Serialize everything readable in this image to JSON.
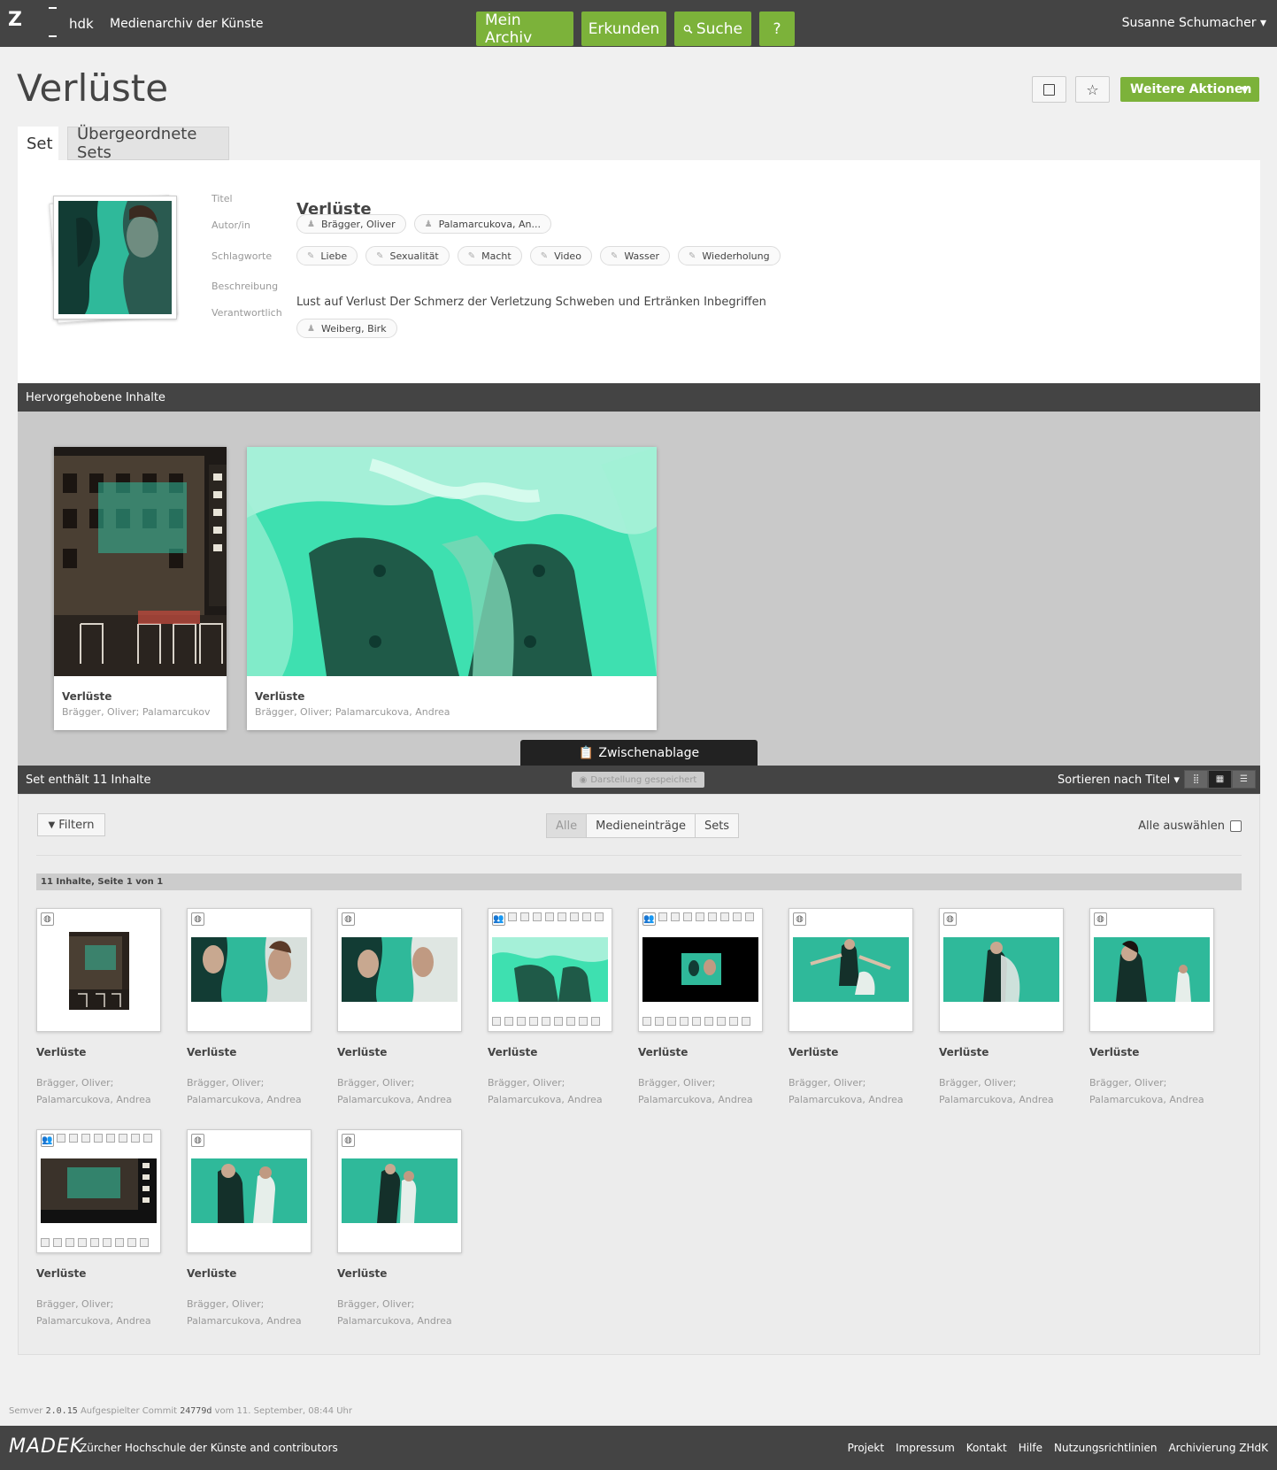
{
  "topbar": {
    "logo": "Z",
    "brand_short": "hdk",
    "brand_title": "Medienarchiv der Künste",
    "nav": [
      "Mein Archiv",
      "Erkunden",
      "Suche",
      "?"
    ],
    "user": "Susanne Schumacher ▾"
  },
  "page": {
    "title": "Verlüste",
    "more_actions": "Weitere Aktionen",
    "tabs": [
      "Set",
      "Übergeordnete Sets"
    ]
  },
  "meta": {
    "labels": [
      "Titel",
      "Autor/in",
      "Schlagworte",
      "Beschreibung",
      "Verantwortlich"
    ],
    "title": "Verlüste",
    "authors": [
      "Brägger, Oliver",
      "Palamarcukova, An..."
    ],
    "keywords": [
      "Liebe",
      "Sexualität",
      "Macht",
      "Video",
      "Wasser",
      "Wiederholung"
    ],
    "description": "Lust auf Verlust Der Schmerz der Verletzung Schweben und Ertränken Inbegriffen",
    "responsible": [
      "Weiberg, Birk"
    ]
  },
  "highlights": {
    "header": "Hervorgehobene Inhalte",
    "cards": [
      {
        "title": "Verlüste",
        "sub": "Brägger, Oliver; Palamarcukov"
      },
      {
        "title": "Verlüste",
        "sub": "Brägger, Oliver; Palamarcukova, Andrea"
      }
    ],
    "clipboard": "Zwischenablage"
  },
  "setbar": {
    "count": "Set enthält 11 Inhalte",
    "saved": "Darstellung gespeichert",
    "sort": "Sortieren nach Titel ▾"
  },
  "grid": {
    "filter": "Filtern",
    "segments": [
      "Alle",
      "Medieneinträge",
      "Sets"
    ],
    "select_all": "Alle auswählen",
    "page_info": "11 Inhalte, Seite 1 von 1",
    "items": [
      {
        "title": "Verlüste",
        "a1": "Brägger, Oliver;",
        "a2": "Palamarcukova, Andrea"
      },
      {
        "title": "Verlüste",
        "a1": "Brägger, Oliver;",
        "a2": "Palamarcukova, Andrea"
      },
      {
        "title": "Verlüste",
        "a1": "Brägger, Oliver;",
        "a2": "Palamarcukova, Andrea"
      },
      {
        "title": "Verlüste",
        "a1": "Brägger, Oliver;",
        "a2": "Palamarcukova, Andrea"
      },
      {
        "title": "Verlüste",
        "a1": "Brägger, Oliver;",
        "a2": "Palamarcukova, Andrea"
      },
      {
        "title": "Verlüste",
        "a1": "Brägger, Oliver;",
        "a2": "Palamarcukova, Andrea"
      },
      {
        "title": "Verlüste",
        "a1": "Brägger, Oliver;",
        "a2": "Palamarcukova, Andrea"
      },
      {
        "title": "Verlüste",
        "a1": "Brägger, Oliver;",
        "a2": "Palamarcukova, Andrea"
      },
      {
        "title": "Verlüste",
        "a1": "Brägger, Oliver;",
        "a2": "Palamarcukova, Andrea"
      },
      {
        "title": "Verlüste",
        "a1": "Brägger, Oliver;",
        "a2": "Palamarcukova, Andrea"
      },
      {
        "title": "Verlüste",
        "a1": "Brägger, Oliver;",
        "a2": "Palamarcukova, Andrea"
      }
    ]
  },
  "footer": {
    "build_prefix": "Semver",
    "version": "2.0.15",
    "commit_label": "Aufgespielter Commit",
    "commit": "24779d",
    "date": "vom 11. September, 08:44 Uhr",
    "logo": "MADEK",
    "copyright": "Zürcher Hochschule der Künste and contributors",
    "links": [
      "Projekt",
      "Impressum",
      "Kontakt",
      "Hilfe",
      "Nutzungsrichtlinien",
      "Archivierung ZHdK"
    ]
  },
  "colors": {
    "accent": "#7cb23a",
    "bar": "#444444",
    "teal": "#3fc9a4"
  }
}
